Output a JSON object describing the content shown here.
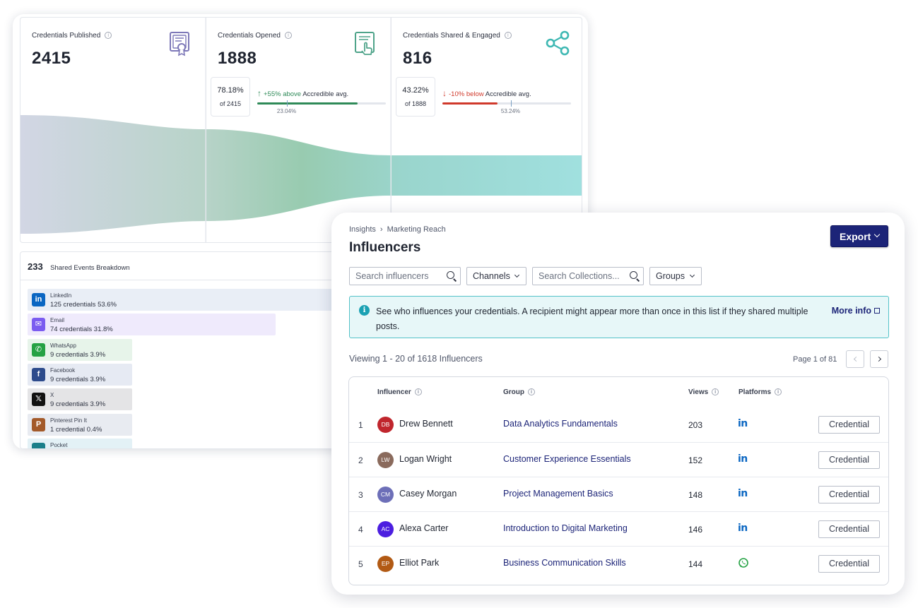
{
  "funnel": {
    "metrics": [
      {
        "label": "Credentials Published",
        "value": "2415",
        "icon": "certificate-icon"
      },
      {
        "label": "Credentials Opened",
        "value": "1888",
        "icon": "certificate-click-icon",
        "pct": "78.18%",
        "of": "of 2415",
        "delta": "+55% above",
        "suffix": "Accredible avg.",
        "direction": "up",
        "fill": 0.78,
        "avg_label": "23.04%",
        "avg_pos": 0.2304
      },
      {
        "label": "Credentials Shared & Engaged",
        "value": "816",
        "icon": "share-icon",
        "pct": "43.22%",
        "of": "of 1888",
        "delta": "-10% below",
        "suffix": "Accredible avg.",
        "direction": "down",
        "fill": 0.43,
        "avg_label": "53.24%",
        "avg_pos": 0.5324
      }
    ]
  },
  "shared": {
    "count": "233",
    "label": "Shared Events Breakdown",
    "items": [
      {
        "name": "LinkedIn",
        "detail": "125 credentials 53.6%",
        "share": 0.536,
        "bg": "#e9eef6",
        "icon_bg": "#0a66c2",
        "icon": "linkedin-icon",
        "glyph": "in"
      },
      {
        "name": "Email",
        "detail": "74 credentials 31.8%",
        "share": 0.318,
        "bg": "#efeafc",
        "icon_bg": "#7b5cf0",
        "icon": "email-icon",
        "glyph": "✉"
      },
      {
        "name": "WhatsApp",
        "detail": "9 credentials 3.9%",
        "share": 0.039,
        "bg": "#e7f4ea",
        "icon_bg": "#25a244",
        "icon": "whatsapp-icon",
        "glyph": "✆"
      },
      {
        "name": "Facebook",
        "detail": "9 credentials 3.9%",
        "share": 0.039,
        "bg": "#e6eaf3",
        "icon_bg": "#2d4b8c",
        "icon": "facebook-icon",
        "glyph": "f"
      },
      {
        "name": "X",
        "detail": "9 credentials 3.9%",
        "share": 0.039,
        "bg": "#e4e4e6",
        "icon_bg": "#111111",
        "icon": "x-icon",
        "glyph": "𝕏"
      },
      {
        "name": "Pinterest Pin It",
        "detail": "1 credential 0.4%",
        "share": 0.004,
        "bg": "#e8ebf1",
        "icon_bg": "#a35a2a",
        "icon": "pinterest-icon",
        "glyph": "P"
      },
      {
        "name": "Pocket",
        "detail": "",
        "share": 0.004,
        "bg": "#e3f1f6",
        "icon_bg": "#1b7f8a",
        "icon": "pocket-icon",
        "glyph": ""
      }
    ]
  },
  "influencers": {
    "breadcrumb": [
      "Insights",
      "Marketing Reach"
    ],
    "title": "Influencers",
    "export_label": "Export",
    "filters": {
      "search_placeholder": "Search influencers",
      "channels_label": "Channels",
      "collections_placeholder": "Search Collections...",
      "groups_label": "Groups"
    },
    "banner": {
      "text": "See who influences your credentials. A recipient might appear more than once in this list if they shared multiple posts.",
      "more": "More info"
    },
    "viewing": "Viewing 1 - 20 of 1618 Influencers",
    "page": "Page 1 of 81",
    "columns": {
      "influencer": "Influencer",
      "group": "Group",
      "views": "Views",
      "platforms": "Platforms"
    },
    "credential_label": "Credential",
    "rows": [
      {
        "idx": "1",
        "initials": "DB",
        "name": "Drew Bennett",
        "group": "Data Analytics Fundamentals",
        "views": "203",
        "platform": "linkedin",
        "avatar": "#c0262d"
      },
      {
        "idx": "2",
        "initials": "LW",
        "name": "Logan Wright",
        "group": "Customer Experience Essentials",
        "views": "152",
        "platform": "linkedin",
        "avatar": "#8a6a5c"
      },
      {
        "idx": "3",
        "initials": "CM",
        "name": "Casey Morgan",
        "group": "Project Management Basics",
        "views": "148",
        "platform": "linkedin",
        "avatar": "#6d6fb8"
      },
      {
        "idx": "4",
        "initials": "AC",
        "name": "Alexa Carter",
        "group": "Introduction to Digital Marketing",
        "views": "146",
        "platform": "linkedin",
        "avatar": "#4c1ee0"
      },
      {
        "idx": "5",
        "initials": "EP",
        "name": "Elliot Park",
        "group": "Business Communication Skills",
        "views": "144",
        "platform": "whatsapp",
        "avatar": "#b25a14"
      }
    ]
  },
  "colors": {
    "accent": "#1c2478",
    "up": "#2f8a58",
    "down": "#d0392b",
    "linkedin": "#0a66c2",
    "whatsapp": "#25a244"
  }
}
